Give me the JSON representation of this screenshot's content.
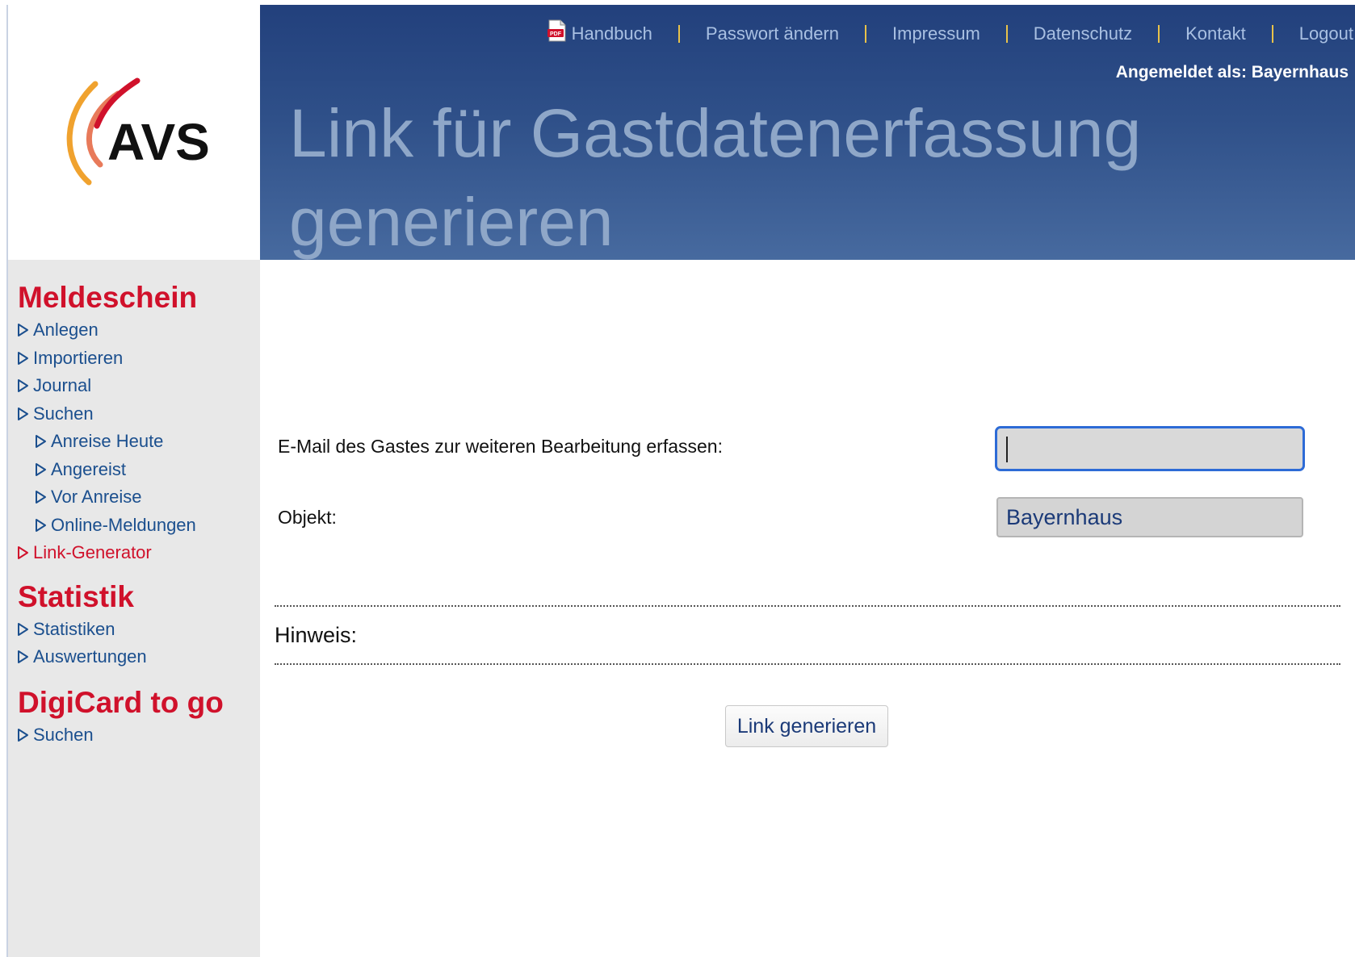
{
  "header": {
    "nav": {
      "handbuch": "Handbuch",
      "passwort": "Passwort ändern",
      "impressum": "Impressum",
      "datenschutz": "Datenschutz",
      "kontakt": "Kontakt",
      "logout": "Logout"
    },
    "pdf_icon_text": "PDF",
    "login_info": "Angemeldet als: Bayernhaus",
    "page_title": "Link für Gastdatenerfassung generieren"
  },
  "logo": {
    "text": "AVS"
  },
  "sidebar": {
    "sections": [
      {
        "title": "Meldeschein",
        "items": [
          "Anlegen",
          "Importieren",
          "Journal",
          "Suchen",
          "Anreise Heute",
          "Angereist",
          "Vor Anreise",
          "Online-Meldungen",
          "Link-Generator"
        ]
      },
      {
        "title": "Statistik",
        "items": [
          "Statistiken",
          "Auswertungen"
        ]
      },
      {
        "title": "DigiCard to go",
        "items": [
          "Suchen"
        ]
      }
    ]
  },
  "form": {
    "email_label": "E-Mail des Gastes zur weiteren Bearbeitung erfassen:",
    "email_value": "",
    "objekt_label": "Objekt:",
    "objekt_value": "Bayernhaus",
    "hinweis_label": "Hinweis:",
    "submit_label": "Link generieren"
  },
  "colors": {
    "header_top": "#22407c",
    "header_bottom": "#476a9f",
    "accent_red": "#d0112b",
    "link_blue": "#1b4f8e",
    "sidebar_bg": "#e8e8e8",
    "input_focus": "#2d6bd6"
  },
  "icons": [
    "pdf-icon",
    "triangle-right-icon"
  ]
}
